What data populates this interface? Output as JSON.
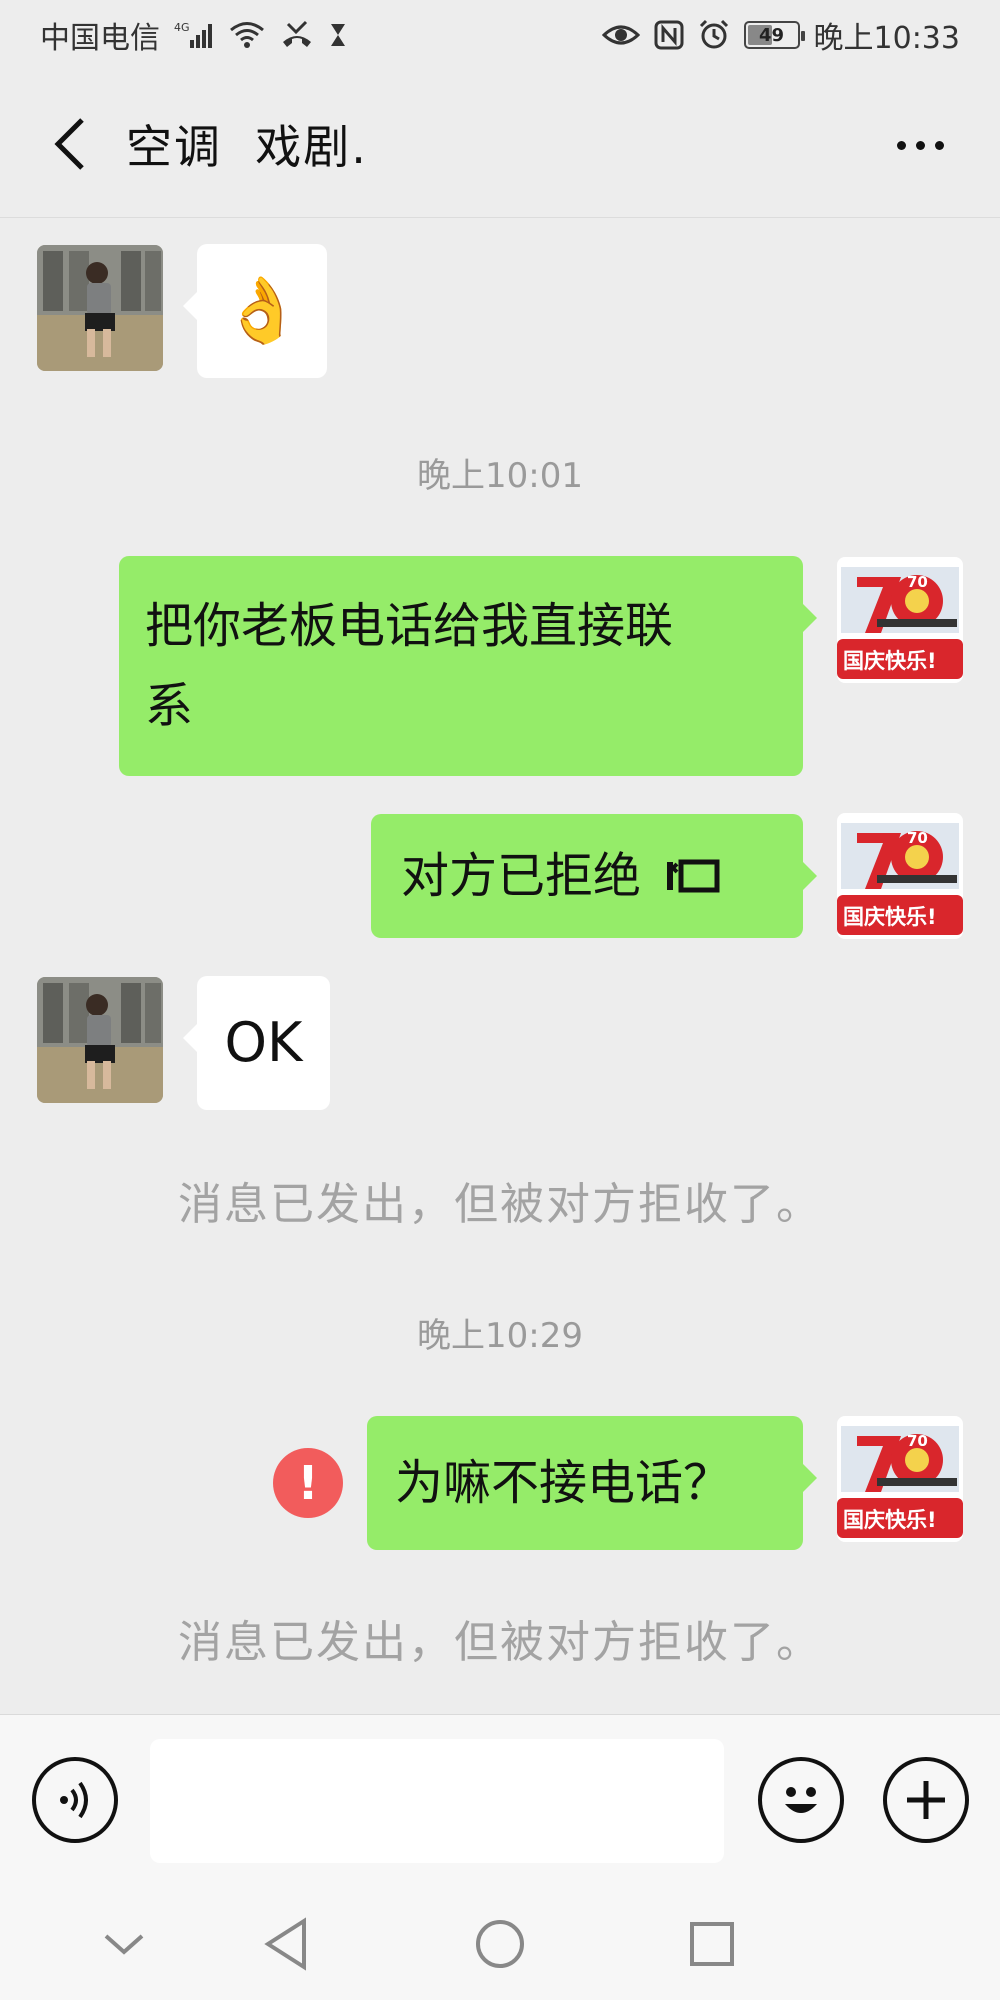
{
  "status_bar": {
    "carrier": "中国电信",
    "network": "4G",
    "battery": "49",
    "battery_level": 0.49,
    "time": "晚上10:33"
  },
  "header": {
    "title": "空调  戏剧."
  },
  "messages": [
    {
      "side": "left",
      "type": "emoji",
      "content": "👌"
    },
    {
      "type": "time",
      "content": "晚上10:01"
    },
    {
      "side": "right",
      "type": "text",
      "lines": [
        "把你老板电话给我直接联",
        "系"
      ]
    },
    {
      "side": "right",
      "type": "text",
      "content": "对方已拒绝",
      "suffix_icon": "call-declined-icon"
    },
    {
      "side": "left",
      "type": "text",
      "content": "OK"
    },
    {
      "type": "system",
      "content": "消息已发出，但被对方拒收了。"
    },
    {
      "type": "time",
      "content": "晚上10:29"
    },
    {
      "side": "right",
      "type": "text",
      "content": "为嘛不接电话？",
      "status": "failed",
      "status_glyph": "!"
    },
    {
      "type": "system",
      "content": "消息已发出，但被对方拒收了。"
    }
  ],
  "avatar_text": {
    "right": "国庆快乐!",
    "right_number": "70"
  },
  "input_bar": {
    "placeholder": ""
  },
  "colors": {
    "background": "#ededed",
    "bubble_green": "#95ec69",
    "bubble_white": "#ffffff",
    "error_red": "#f25c5c",
    "avatar_red": "#d9262c"
  }
}
